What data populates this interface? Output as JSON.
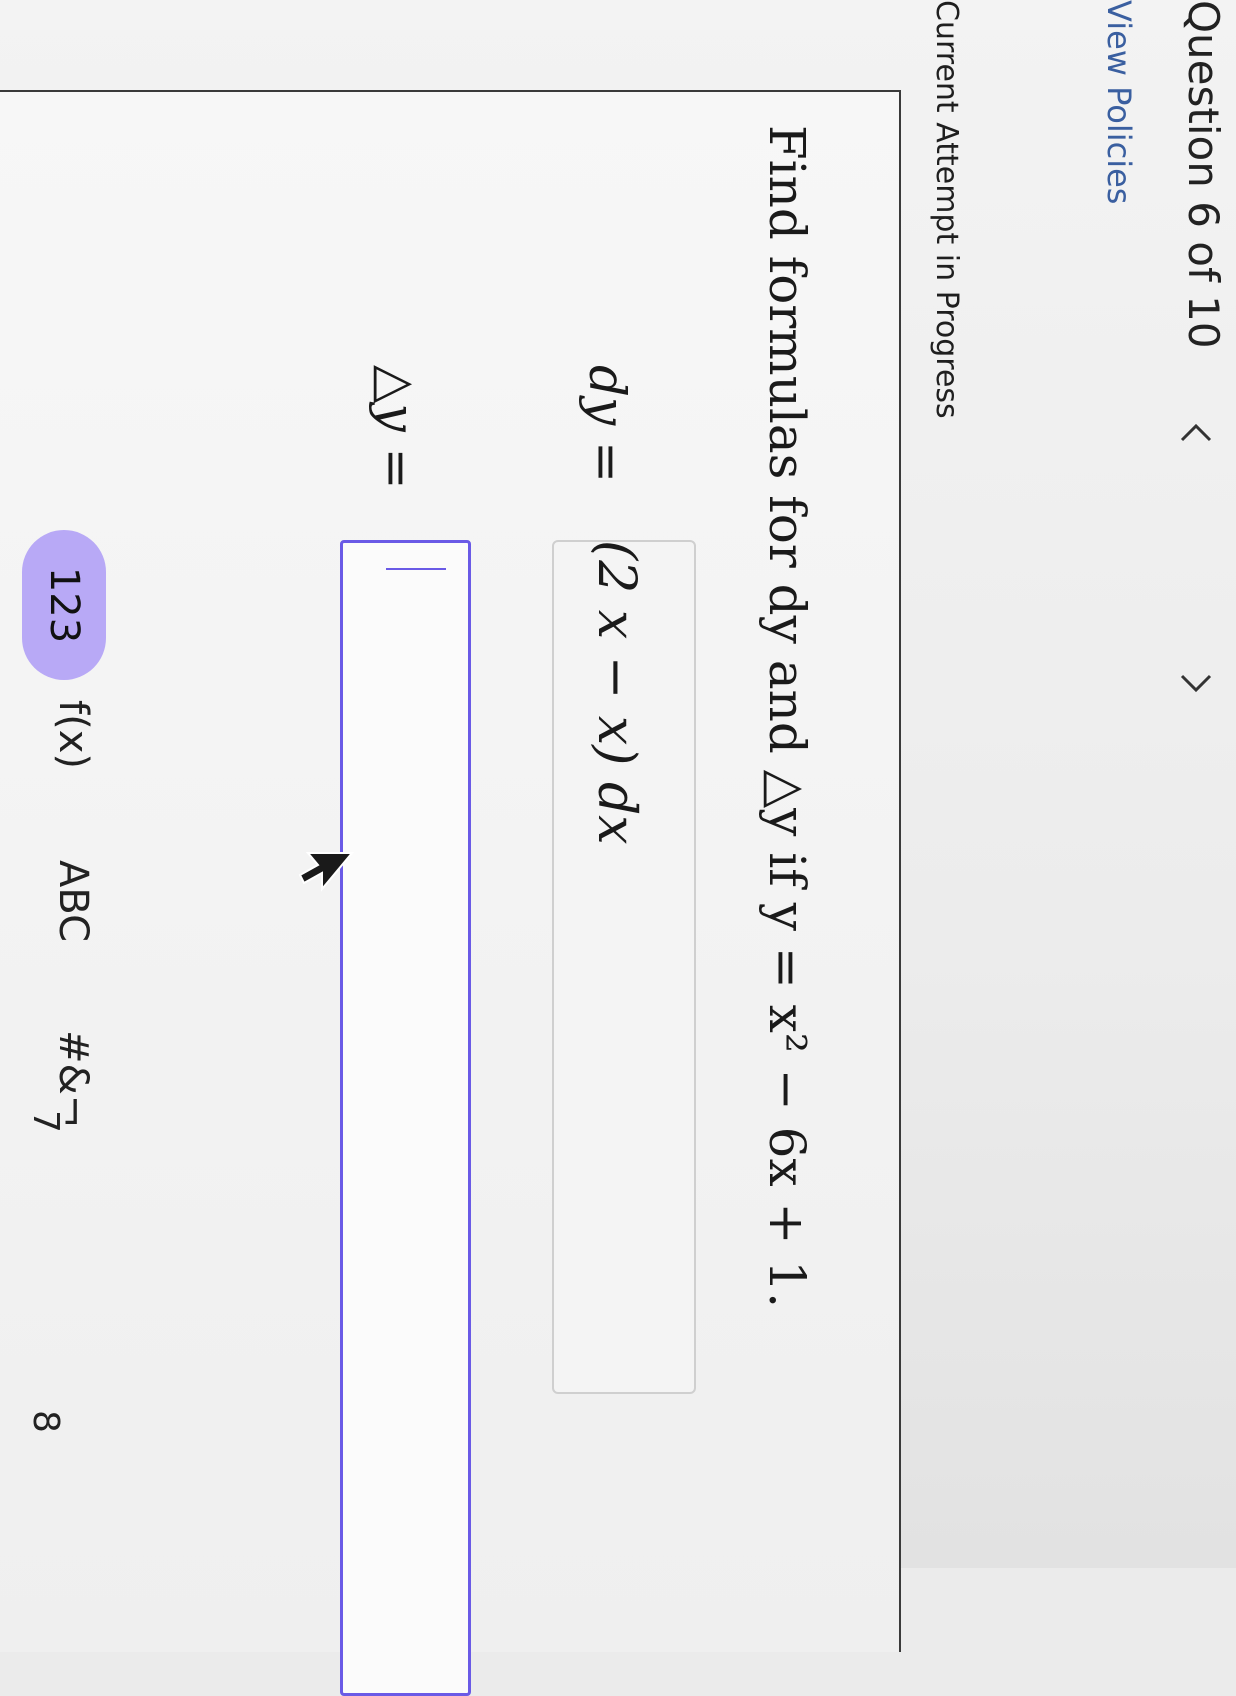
{
  "header": {
    "question_label": "Question 6 of 10",
    "prev_icon": "chevron-left-icon",
    "next_icon": "chevron-right-icon",
    "view_policies": "View Policies",
    "attempt_status": "Current Attempt in Progress"
  },
  "problem": {
    "prompt": "Find formulas for dy and △y if y = x² − 6x + 1.",
    "dy_label": "dy =",
    "dy_answer": "(2 x − x) dx",
    "delta_y_label": "△y =",
    "delta_y_answer": ""
  },
  "keyboard": {
    "tabs": [
      "123",
      "f(x)",
      "ABC",
      "#&¬"
    ],
    "active_tab": "123",
    "keys": [
      "7",
      "8"
    ]
  },
  "colors": {
    "accent": "#6a5ae6",
    "active_tab_bg": "#b8a9f6",
    "link": "#3a5fa0"
  }
}
